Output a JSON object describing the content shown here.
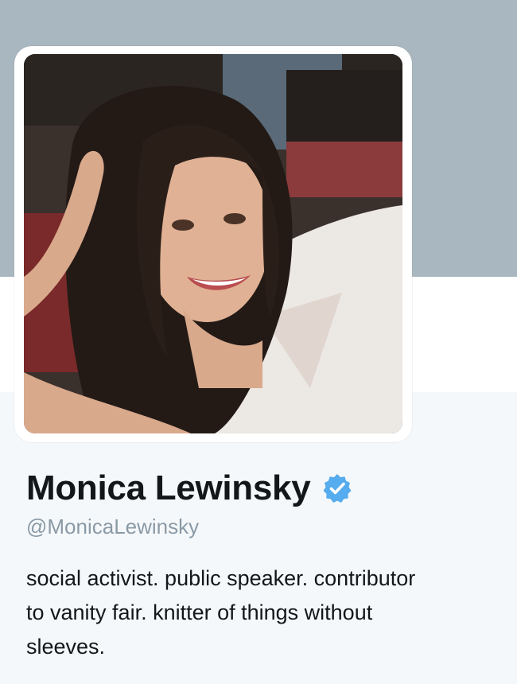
{
  "profile": {
    "name": "Monica Lewinsky",
    "handle": "@MonicaLewinsky",
    "bio": "social activist. public speaker. contributor\nto vanity fair. knitter of things without\nsleeves.",
    "verified": true
  },
  "colors": {
    "header_banner": "#a9b7c0",
    "background": "#f5f8fa",
    "verified_badge": "#55acee",
    "name_text": "#14171a",
    "handle_text": "#8a9aa6"
  },
  "icons": {
    "verified": "verified-badge-icon",
    "avatar": "profile-photo"
  }
}
